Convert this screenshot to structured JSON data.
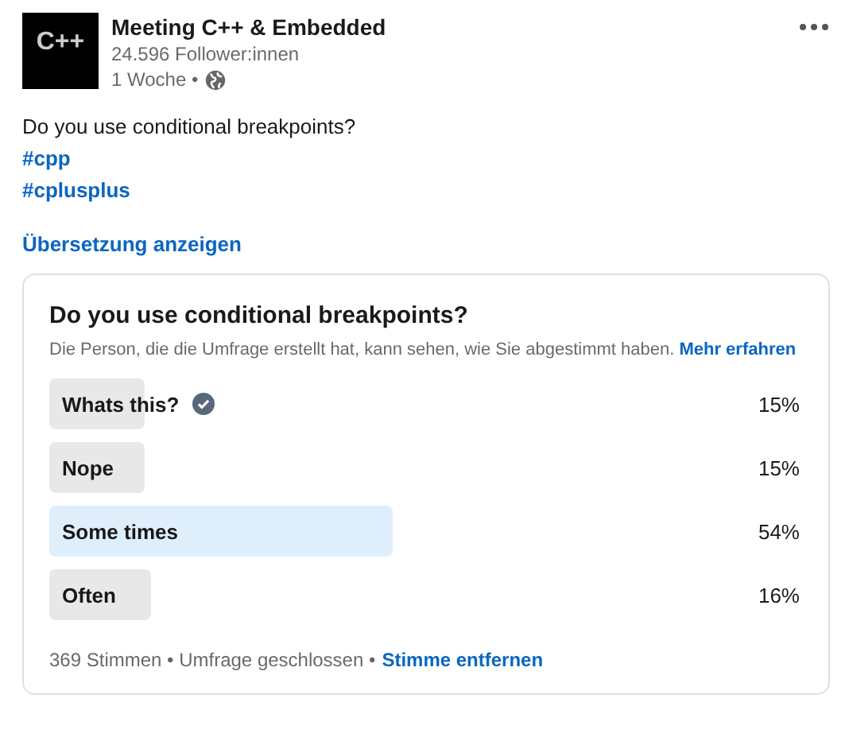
{
  "author": {
    "logo_text": "C++",
    "name": "Meeting C++ & Embedded",
    "followers": "24.596 Follower:innen",
    "time": "1 Woche •"
  },
  "post": {
    "text": "Do you use conditional breakpoints?",
    "hashtags": [
      "#cpp",
      "#cplusplus"
    ],
    "translate_link": "Übersetzung anzeigen"
  },
  "poll": {
    "question": "Do you use conditional breakpoints?",
    "notice": "Die Person, die die Umfrage erstellt hat, kann sehen, wie Sie abgestimmt haben.",
    "notice_link": "Mehr erfahren",
    "options": [
      {
        "label": "Whats this?",
        "percent": "15%",
        "selected": true,
        "leading": false
      },
      {
        "label": "Nope",
        "percent": "15%",
        "selected": false,
        "leading": false
      },
      {
        "label": "Some times",
        "percent": "54%",
        "selected": false,
        "leading": true
      },
      {
        "label": "Often",
        "percent": "16%",
        "selected": false,
        "leading": false
      }
    ],
    "votes": "369 Stimmen",
    "separator": "•",
    "status": "Umfrage geschlossen",
    "remove_vote": "Stimme entfernen"
  }
}
